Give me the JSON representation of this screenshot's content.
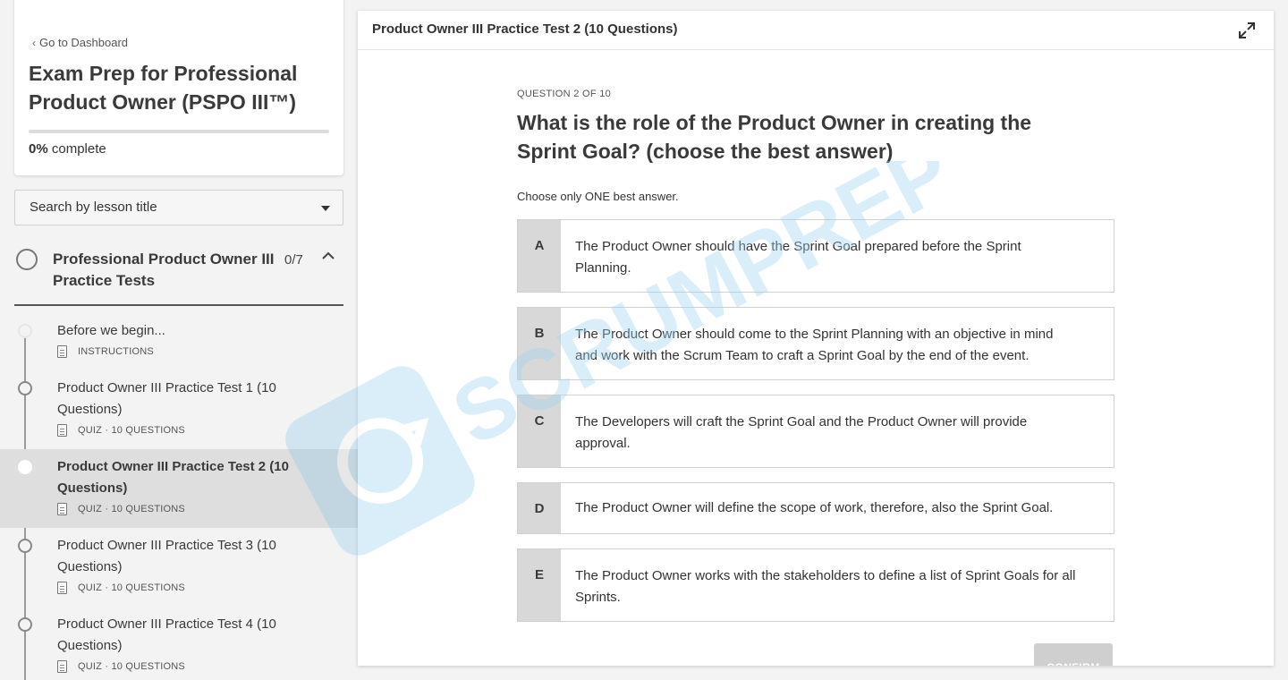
{
  "sidebar": {
    "back_link": "Go to Dashboard",
    "course_title": "Exam Prep for Professional Product Owner (PSPO III™)",
    "progress": {
      "percent": 0,
      "percent_label": "0%",
      "suffix": " complete"
    },
    "search": {
      "placeholder": "Search by lesson title"
    },
    "section": {
      "title": "Professional Product Owner III Practice Tests",
      "count": "0/7"
    },
    "lessons": [
      {
        "title": "Before we begin...",
        "meta": "INSTRUCTIONS"
      },
      {
        "title": "Product Owner III Practice Test 1 (10 Questions)",
        "meta": "QUIZ · 10 QUESTIONS"
      },
      {
        "title": "Product Owner III Practice Test 2 (10 Questions)",
        "meta": "QUIZ · 10 QUESTIONS"
      },
      {
        "title": "Product Owner III Practice Test 3 (10 Questions)",
        "meta": "QUIZ · 10 QUESTIONS"
      },
      {
        "title": "Product Owner III Practice Test 4 (10 Questions)",
        "meta": "QUIZ · 10 QUESTIONS"
      }
    ]
  },
  "watermark": {
    "text": "SCRUMPREP"
  },
  "main": {
    "title": "Product Owner III Practice Test 2 (10 Questions)",
    "question_label": "QUESTION 2 OF 10",
    "question": "What is the role of the Product Owner in creating the Sprint Goal? (choose the best answer)",
    "instruction": "Choose only ONE best answer.",
    "options": [
      {
        "letter": "A",
        "text": "The Product Owner should have the Sprint Goal prepared before the Sprint Planning."
      },
      {
        "letter": "B",
        "text": "The Product Owner should come to the Sprint Planning with an objective in mind and work with the Scrum Team to craft a Sprint Goal by the end of the event."
      },
      {
        "letter": "C",
        "text": "The Developers will craft the Sprint Goal and the Product Owner will provide approval."
      },
      {
        "letter": "D",
        "text": "The Product Owner will define the scope of work, therefore, also the Sprint Goal."
      },
      {
        "letter": "E",
        "text": "The Product Owner works with the stakeholders to define a list of Sprint Goals for all Sprints."
      }
    ],
    "confirm_label": "CONFIRM"
  },
  "colors": {
    "progress_fill": "#2b7a2b",
    "option_letter_bg": "#d8d8d8",
    "confirm_disabled": "#cfcfcf",
    "watermark": "#9fd3f2"
  }
}
